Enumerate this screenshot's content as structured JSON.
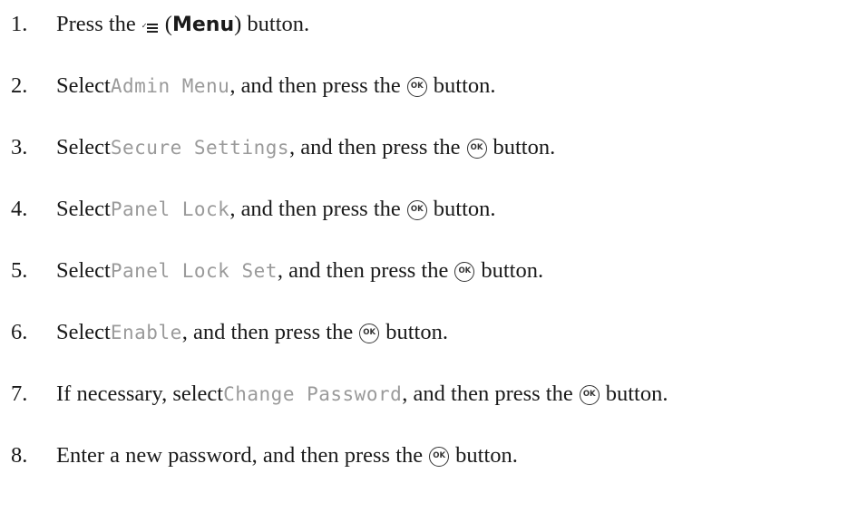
{
  "steps": [
    {
      "num": "1.",
      "t1": "Press the",
      "menu_open": " (",
      "menu_label": "Menu",
      "menu_close": ") button."
    },
    {
      "num": "2.",
      "t1": "Select ",
      "lcd": "Admin Menu",
      "t2": ", and then press the",
      "t3": "button."
    },
    {
      "num": "3.",
      "t1": "Select ",
      "lcd": "Secure Settings",
      "t2": ", and then press the",
      "t3": "button."
    },
    {
      "num": "4.",
      "t1": "Select ",
      "lcd": "Panel Lock",
      "t2": ", and then press the",
      "t3": "button."
    },
    {
      "num": "5.",
      "t1": "Select ",
      "lcd": "Panel Lock Set",
      "t2": ", and then press the",
      "t3": "button."
    },
    {
      "num": "6.",
      "t1": "Select ",
      "lcd": "Enable",
      "t2": ", and then press the",
      "t3": "button."
    },
    {
      "num": "7.",
      "t1": "If necessary, select ",
      "lcd": "Change Password",
      "t2": ", and then press the",
      "t3": "button."
    },
    {
      "num": "8.",
      "t1": "Enter a new password, and then press the",
      "t3": "button."
    }
  ],
  "icons": {
    "menu": "menu-list-icon",
    "ok": "ok-button-icon"
  }
}
